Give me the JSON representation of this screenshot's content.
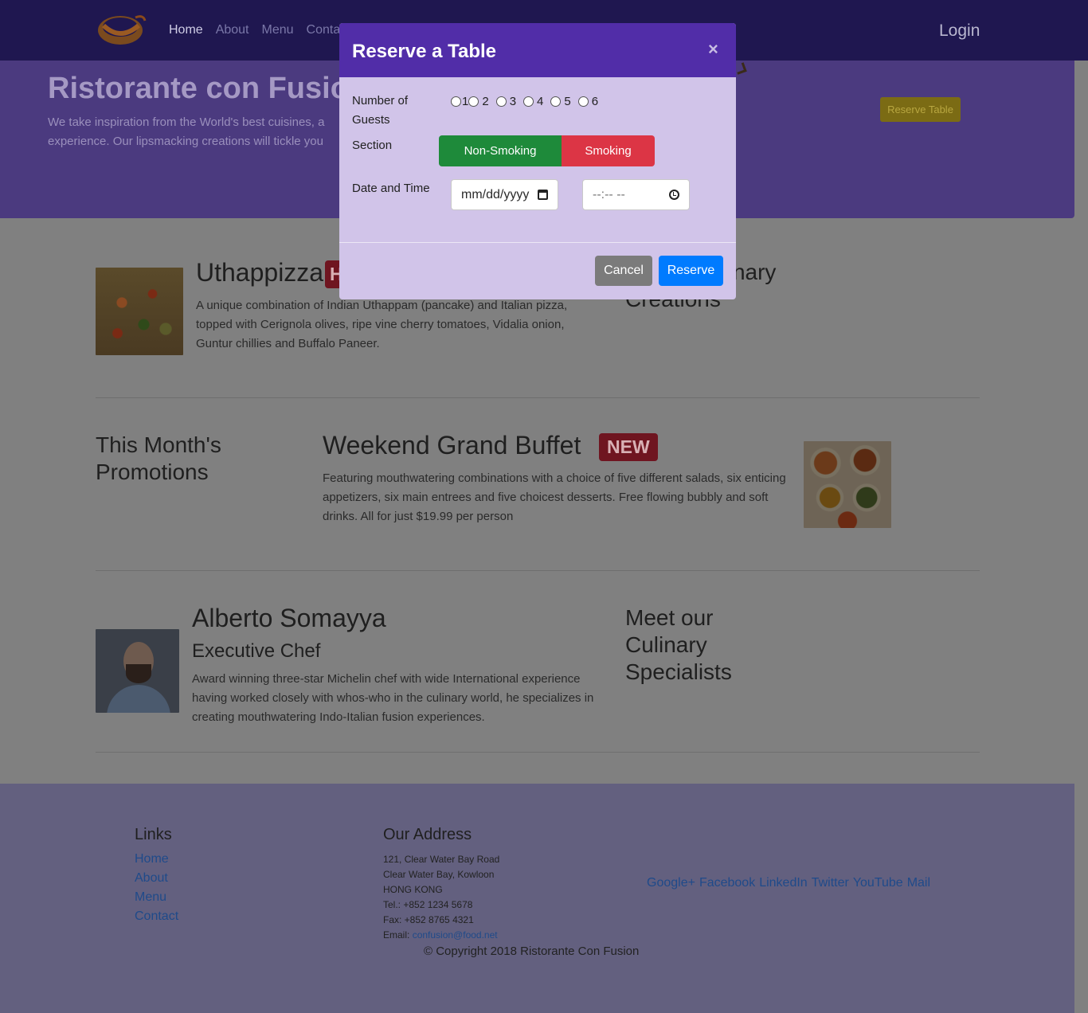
{
  "navbar": {
    "links": [
      "Home",
      "About",
      "Menu",
      "Conta"
    ],
    "login": "Login"
  },
  "jumbotron": {
    "title": "Ristorante con Fusio",
    "text": "We take inspiration from the World's best cuisines, a experience. Our lipsmacking creations will tickle you",
    "reserve_button": "Reserve Table"
  },
  "dish": {
    "name": "Uthappizza",
    "badge": "H",
    "description": "A unique combination of Indian Uthappam (pancake) and Italian pizza, topped with Cerignola olives, ripe vine cherry tomatoes, Vidalia onion, Guntur chillies and Buffalo Paneer.",
    "side_title": "acking Culinary Creations"
  },
  "promotion": {
    "side_title": "This Month's Promotions",
    "name": "Weekend Grand Buffet",
    "badge": "NEW",
    "description": "Featuring mouthwatering combinations with a choice of five different salads, six enticing appetizers, six main entrees and five choicest desserts. Free flowing bubbly and soft drinks. All for just $19.99 per person"
  },
  "leader": {
    "name": "Alberto Somayya",
    "designation": "Executive Chef",
    "description": "Award winning three-star Michelin chef with wide International experience having worked closely with whos-who in the culinary world, he specializes in creating mouthwatering Indo-Italian fusion experiences.",
    "side_title": "Meet our Culinary Specialists"
  },
  "footer": {
    "links_title": "Links",
    "links": [
      "Home",
      "About",
      "Menu",
      "Contact"
    ],
    "address_title": "Our Address",
    "address_lines": [
      "121, Clear Water Bay Road",
      "Clear Water Bay, Kowloon",
      "HONG KONG",
      "Tel.: +852 1234 5678",
      "Fax: +852 8765 4321"
    ],
    "email_label": "Email: ",
    "email": "confusion@food.net",
    "social": [
      "Google+",
      "Facebook",
      "LinkedIn",
      "Twitter",
      "YouTube",
      "Mail"
    ],
    "copyright": "© Copyright 2018 Ristorante Con Fusion"
  },
  "modal": {
    "title": "Reserve a Table",
    "close": "×",
    "guests_label": "Number of Guests",
    "guest_options": [
      "1",
      "2",
      "3",
      "4",
      "5",
      "6"
    ],
    "section_label": "Section",
    "non_smoking": "Non-Smoking",
    "smoking": "Smoking",
    "datetime_label": "Date and Time",
    "date_placeholder": "mm/dd/yyyy",
    "time_placeholder": "--:-- --",
    "cancel": "Cancel",
    "reserve": "Reserve"
  },
  "colors": {
    "modal_header": "#512da8",
    "modal_body": "#d1c4e9",
    "non_smoking": "#1e8a3a",
    "smoking": "#dc3545",
    "reserve_button": "#007bff",
    "cancel_button": "#7b7b7b"
  },
  "icons": {
    "close": "close-icon",
    "date": "calendar-icon",
    "time": "clock-icon"
  }
}
